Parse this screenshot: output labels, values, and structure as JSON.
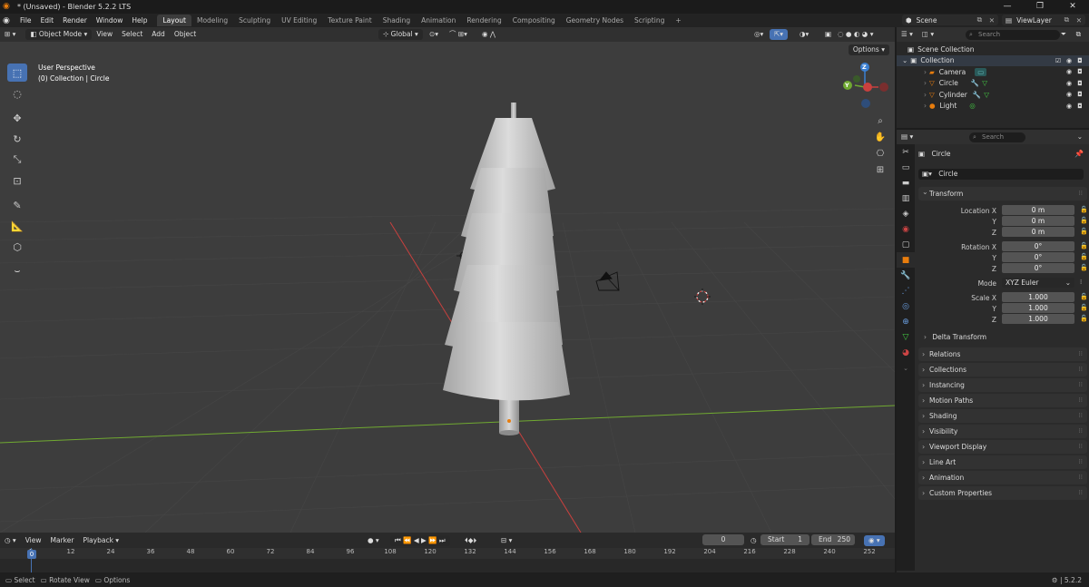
{
  "window": {
    "title": "* (Unsaved) - Blender 5.2.2 LTS",
    "controls": [
      "—",
      "❐",
      "✕"
    ]
  },
  "menu": [
    "File",
    "Edit",
    "Render",
    "Window",
    "Help"
  ],
  "workspaces": [
    {
      "label": "Layout",
      "active": true
    },
    {
      "label": "Modeling"
    },
    {
      "label": "Sculpting"
    },
    {
      "label": "UV Editing"
    },
    {
      "label": "Texture Paint"
    },
    {
      "label": "Shading"
    },
    {
      "label": "Animation"
    },
    {
      "label": "Rendering"
    },
    {
      "label": "Compositing"
    },
    {
      "label": "Geometry Nodes"
    },
    {
      "label": "Scripting"
    }
  ],
  "add_workspace": "+",
  "scene": {
    "label": "Scene",
    "viewlayer": "ViewLayer"
  },
  "viewport": {
    "mode": "Object Mode",
    "menus": [
      "View",
      "Select",
      "Add",
      "Object"
    ],
    "transform_orientation": "Global",
    "options_label": "Options",
    "info_line1": "User Perspective",
    "info_line2": "(0) Collection | Circle",
    "gizmo": {
      "z": "Z",
      "y": "Y"
    }
  },
  "outliner": {
    "search_placeholder": "Search",
    "root": "Scene Collection",
    "collection": "Collection",
    "objects": [
      "Camera",
      "Circle",
      "Cylinder",
      "Light"
    ]
  },
  "properties": {
    "search_placeholder": "Search",
    "object_name": "Circle",
    "data_name": "Circle",
    "transform_label": "Transform",
    "location_label": "Location X",
    "rotation_label": "Rotation X",
    "scale_label": "Scale X",
    "axis_y": "Y",
    "axis_z": "Z",
    "location": [
      "0 m",
      "0 m",
      "0 m"
    ],
    "rotation": [
      "0°",
      "0°",
      "0°"
    ],
    "mode_label": "Mode",
    "mode_value": "XYZ Euler",
    "scale": [
      "1.000",
      "1.000",
      "1.000"
    ],
    "delta_transform": "Delta Transform",
    "panels": [
      "Relations",
      "Collections",
      "Instancing",
      "Motion Paths",
      "Shading",
      "Visibility",
      "Viewport Display",
      "Line Art",
      "Animation",
      "Custom Properties"
    ]
  },
  "timeline": {
    "menus": [
      "View",
      "Marker",
      "Playback"
    ],
    "current_frame": "0",
    "start_label": "Start",
    "start": "1",
    "end_label": "End",
    "end": "250",
    "ticks": [
      "0",
      "12",
      "24",
      "36",
      "48",
      "60",
      "72",
      "84",
      "96",
      "108",
      "120",
      "132",
      "144",
      "156",
      "168",
      "180",
      "192",
      "204",
      "216",
      "228",
      "240",
      "252"
    ]
  },
  "statusbar": {
    "select": "Select",
    "rotate": "Rotate View",
    "options": "Options",
    "version": "5.2.2"
  },
  "colors": {
    "accent": "#4772b3",
    "viewport_bg": "#3d3d3d",
    "x_axis": "#c8403e",
    "y_axis": "#70a931",
    "z_axis": "#3b7fd1",
    "orange": "#e87d0d"
  }
}
